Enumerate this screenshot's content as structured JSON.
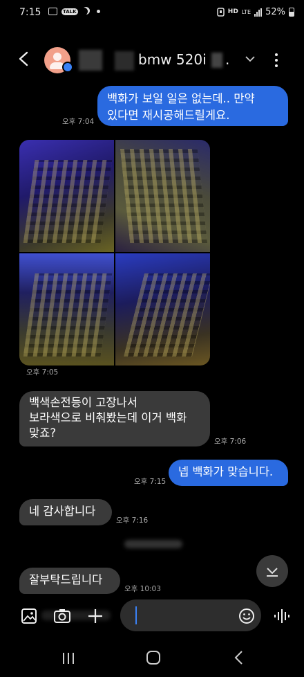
{
  "status_bar": {
    "time": "7:15",
    "notification_icons": [
      "gallery-icon",
      "talk-icon",
      "moon-icon",
      "dot-icon"
    ],
    "hd_label": "HD",
    "network": "LTE",
    "battery": "52%"
  },
  "header": {
    "contact_name": "bmw 520i",
    "name_suffix": ".",
    "avatar_badge_color": "#3b82f6",
    "icons": [
      "back-arrow-icon",
      "avatar-icon",
      "chevron-down-icon",
      "more-vertical-icon"
    ]
  },
  "messages": [
    {
      "type": "sent",
      "text": "백화가 보일 일은 없는데.. 만약\n있다면 재시공해드릴게요.",
      "time": "오후 7:04"
    },
    {
      "type": "received_images",
      "image_count": 4,
      "time": "오후 7:05"
    },
    {
      "type": "received",
      "text": "백색손전등이 고장나서\n보라색으로 비춰봤는데 이거 백화\n맞죠?",
      "time": "오후 7:06"
    },
    {
      "type": "sent",
      "text": "넵 백화가 맞습니다.",
      "time": "오후 7:15"
    },
    {
      "type": "received",
      "text": "네 감사합니다",
      "time": "오후 7:16"
    },
    {
      "type": "received",
      "text": "잘부탁드립니다",
      "time": "오후 10:03"
    }
  ],
  "composer": {
    "icons": [
      "gallery-icon",
      "camera-icon",
      "plus-icon",
      "emoji-icon",
      "voice-icon"
    ]
  },
  "colors": {
    "sent_bubble": "#2a6ae0",
    "received_bubble": "#3a3a3a",
    "background": "#000000"
  },
  "nav_icons": [
    "recents-icon",
    "home-icon",
    "back-icon"
  ]
}
